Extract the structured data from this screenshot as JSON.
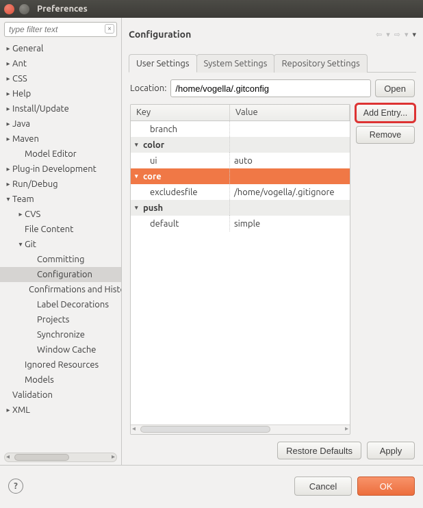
{
  "window": {
    "title": "Preferences"
  },
  "filter": {
    "placeholder": "type filter text"
  },
  "tree": [
    {
      "label": "General",
      "depth": 0,
      "expand": "▸"
    },
    {
      "label": "Ant",
      "depth": 0,
      "expand": "▸"
    },
    {
      "label": "CSS",
      "depth": 0,
      "expand": "▸"
    },
    {
      "label": "Help",
      "depth": 0,
      "expand": "▸"
    },
    {
      "label": "Install/Update",
      "depth": 0,
      "expand": "▸"
    },
    {
      "label": "Java",
      "depth": 0,
      "expand": "▸"
    },
    {
      "label": "Maven",
      "depth": 0,
      "expand": "▸"
    },
    {
      "label": "Model Editor",
      "depth": 1,
      "expand": ""
    },
    {
      "label": "Plug-in Development",
      "depth": 0,
      "expand": "▸"
    },
    {
      "label": "Run/Debug",
      "depth": 0,
      "expand": "▸"
    },
    {
      "label": "Team",
      "depth": 0,
      "expand": "▾"
    },
    {
      "label": "CVS",
      "depth": 1,
      "expand": "▸"
    },
    {
      "label": "File Content",
      "depth": 1,
      "expand": ""
    },
    {
      "label": "Git",
      "depth": 1,
      "expand": "▾"
    },
    {
      "label": "Committing",
      "depth": 2,
      "expand": ""
    },
    {
      "label": "Configuration",
      "depth": 2,
      "expand": "",
      "selected": true
    },
    {
      "label": "Confirmations and History",
      "depth": 2,
      "expand": ""
    },
    {
      "label": "Label Decorations",
      "depth": 2,
      "expand": ""
    },
    {
      "label": "Projects",
      "depth": 2,
      "expand": ""
    },
    {
      "label": "Synchronize",
      "depth": 2,
      "expand": ""
    },
    {
      "label": "Window Cache",
      "depth": 2,
      "expand": ""
    },
    {
      "label": "Ignored Resources",
      "depth": 1,
      "expand": ""
    },
    {
      "label": "Models",
      "depth": 1,
      "expand": ""
    },
    {
      "label": "Validation",
      "depth": 0,
      "expand": ""
    },
    {
      "label": "XML",
      "depth": 0,
      "expand": "▸"
    }
  ],
  "page": {
    "title": "Configuration"
  },
  "tabs": [
    {
      "label": "User Settings",
      "active": true
    },
    {
      "label": "System Settings"
    },
    {
      "label": "Repository Settings"
    }
  ],
  "location": {
    "label": "Location:",
    "value": "/home/vogella/.gitconfig",
    "open": "Open"
  },
  "table": {
    "headers": {
      "key": "Key",
      "value": "Value"
    },
    "rows": [
      {
        "type": "child",
        "key": "branch",
        "value": ""
      },
      {
        "type": "section",
        "key": "color",
        "value": "",
        "tw": "▾"
      },
      {
        "type": "child",
        "key": "ui",
        "value": "auto"
      },
      {
        "type": "section",
        "key": "core",
        "value": "",
        "tw": "▾",
        "selected": true
      },
      {
        "type": "child",
        "key": "excludesfile",
        "value": "/home/vogella/.gitignore"
      },
      {
        "type": "section",
        "key": "push",
        "value": "",
        "tw": "▾"
      },
      {
        "type": "child",
        "key": "default",
        "value": "simple"
      }
    ]
  },
  "side": {
    "add": "Add Entry...",
    "remove": "Remove"
  },
  "bottom": {
    "restore": "Restore Defaults",
    "apply": "Apply"
  },
  "footer": {
    "cancel": "Cancel",
    "ok": "OK"
  }
}
